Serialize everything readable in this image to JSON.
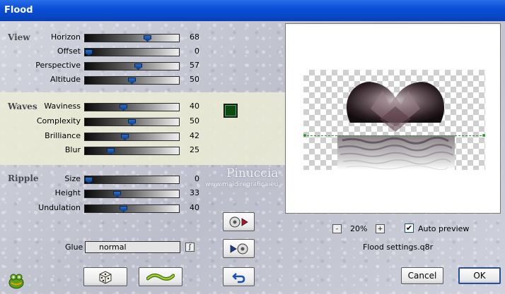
{
  "window": {
    "title": "Flood"
  },
  "sections": {
    "view": "View",
    "waves": "Waves",
    "ripple": "Ripple"
  },
  "view": [
    {
      "label": "Horizon",
      "value": "68",
      "fraction": 0.68
    },
    {
      "label": "Offset",
      "value": "0",
      "fraction": 0.0
    },
    {
      "label": "Perspective",
      "value": "57",
      "fraction": 0.57
    },
    {
      "label": "Altitude",
      "value": "50",
      "fraction": 0.5
    }
  ],
  "waves": [
    {
      "label": "Waviness",
      "value": "40",
      "fraction": 0.4
    },
    {
      "label": "Complexity",
      "value": "50",
      "fraction": 0.5
    },
    {
      "label": "Brilliance",
      "value": "42",
      "fraction": 0.42
    },
    {
      "label": "Blur",
      "value": "25",
      "fraction": 0.25
    }
  ],
  "ripple": [
    {
      "label": "Size",
      "value": "0",
      "fraction": 0.0
    },
    {
      "label": "Height",
      "value": "33",
      "fraction": 0.33
    },
    {
      "label": "Undulation",
      "value": "40",
      "fraction": 0.4
    }
  ],
  "waves_color": "#0e4a0e",
  "glue": {
    "label": "Glue",
    "value": "normal",
    "button": "ʃ"
  },
  "zoom": {
    "minus": "-",
    "value": "20%",
    "plus": "+"
  },
  "auto_preview": {
    "label": "Auto preview",
    "checked": true,
    "mark": "✔"
  },
  "settings_file": "Flood settings.q8r",
  "buttons": {
    "cancel": "Cancel",
    "ok": "OK"
  },
  "watermark": {
    "name": "Pinuccia",
    "url": "www.maidiregrafica.eu"
  },
  "icons": {
    "logo": "frog-logo-icon",
    "randomize": "dice-icon",
    "reset": "wave-icon",
    "save": "disc-arrow-out-icon",
    "load": "disc-arrow-in-icon",
    "undo": "undo-arrow-icon"
  }
}
